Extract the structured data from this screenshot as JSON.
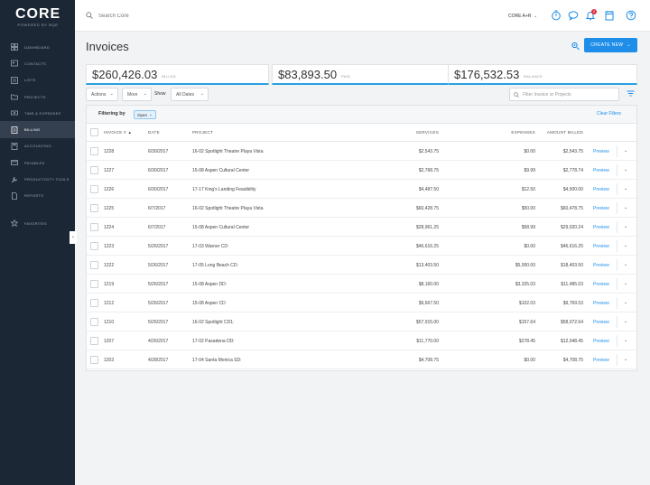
{
  "brand": {
    "name": "CORE",
    "tagline": "POWERED BY BQE"
  },
  "sidebar": {
    "items": [
      {
        "label": "Dashboard",
        "icon": "dashboard-icon"
      },
      {
        "label": "Contacts",
        "icon": "contacts-icon"
      },
      {
        "label": "Lists",
        "icon": "lists-icon"
      },
      {
        "label": "Projects",
        "icon": "projects-icon"
      },
      {
        "label": "Time & Expenses",
        "icon": "time-expenses-icon"
      },
      {
        "label": "Billing",
        "icon": "billing-icon",
        "active": true
      },
      {
        "label": "Accounting",
        "icon": "accounting-icon"
      },
      {
        "label": "Payables",
        "icon": "payables-icon"
      },
      {
        "label": "Productivity Tools",
        "icon": "productivity-tools-icon"
      },
      {
        "label": "Reports",
        "icon": "reports-icon"
      },
      {
        "label": "Favorites",
        "icon": "star-icon"
      }
    ]
  },
  "topbar": {
    "search_placeholder": "Search Core",
    "user_name": "CORE A+R",
    "notification_count": "2"
  },
  "page": {
    "title": "Invoices",
    "create_label": "CREATE NEW"
  },
  "summary": [
    {
      "amount": "$260,426.03",
      "label": "BILLED"
    },
    {
      "amount": "$83,893.50",
      "label": "PAID"
    },
    {
      "amount": "$176,532.53",
      "label": "BALANCE"
    }
  ],
  "toolbar": {
    "actions_label": "Actions",
    "more_label": "More",
    "show_label": "Show",
    "dates_label": "All Dates",
    "filter_placeholder": "Filter Invoice or Projects"
  },
  "filter": {
    "label": "Filtering by",
    "chip": "Open",
    "clear_label": "Clear Filters"
  },
  "table": {
    "columns": {
      "invoice": "INVOICE #",
      "date": "DATE",
      "project": "PROJECT",
      "services": "SERVICES",
      "expenses": "EXPENSES",
      "amount": "AMOUNT BILLED"
    },
    "preview_label": "Preview",
    "rows": [
      {
        "invoice": "1228",
        "date": "6/30/2017",
        "project": "16-02 Spotlight Theatre Playa Vista",
        "services": "$2,543.75",
        "expenses": "$0.00",
        "amount": "$2,543.75"
      },
      {
        "invoice": "1227",
        "date": "6/30/2017",
        "project": "15-08 Aspen Cultural Center",
        "services": "$2,768.75",
        "expenses": "$9.99",
        "amount": "$2,778.74"
      },
      {
        "invoice": "1226",
        "date": "6/30/2017",
        "project": "17-17 King's Landing Feasibility",
        "services": "$4,487.50",
        "expenses": "$12.50",
        "amount": "$4,500.00"
      },
      {
        "invoice": "1225",
        "date": "6/7/2017",
        "project": "16-02 Spotlight Theatre Playa Vista",
        "services": "$60,428.75",
        "expenses": "$50.00",
        "amount": "$60,478.75"
      },
      {
        "invoice": "1224",
        "date": "6/7/2017",
        "project": "15-08 Aspen Cultural Center",
        "services": "$28,961.25",
        "expenses": "$58.99",
        "amount": "$29,020.24"
      },
      {
        "invoice": "1223",
        "date": "5/26/2017",
        "project": "17-03 Warner CD:",
        "services": "$46,616.25",
        "expenses": "$0.00",
        "amount": "$46,616.25"
      },
      {
        "invoice": "1222",
        "date": "5/26/2017",
        "project": "17-05 Long Beach CD:",
        "services": "$13,403.50",
        "expenses": "$5,000.00",
        "amount": "$18,403.50"
      },
      {
        "invoice": "1219",
        "date": "5/26/2017",
        "project": "15-08 Aspen DD:",
        "services": "$8,160.00",
        "expenses": "$3,325.03",
        "amount": "$11,485.03"
      },
      {
        "invoice": "1212",
        "date": "5/26/2017",
        "project": "15-08 Aspen CD",
        "services": "$9,667.50",
        "expenses": "$102.03",
        "amount": "$9,769.53"
      },
      {
        "invoice": "1210",
        "date": "5/26/2017",
        "project": "16-02 Spotlight CD1:",
        "services": "$57,915.00",
        "expenses": "$157.64",
        "amount": "$58,072.64"
      },
      {
        "invoice": "1207",
        "date": "4/26/2017",
        "project": "17-02 Pasadena DD:",
        "services": "$11,770.00",
        "expenses": "$278.45",
        "amount": "$12,048.45"
      },
      {
        "invoice": "1203",
        "date": "4/28/2017",
        "project": "17-04 Santa Monica SD:",
        "services": "$4,708.75",
        "expenses": "$0.00",
        "amount": "$4,708.75"
      }
    ]
  },
  "colors": {
    "sidebar": "#1c2735",
    "accent": "#1f8ee9",
    "active_nav": "#34404f",
    "badge": "#e02f3f"
  }
}
